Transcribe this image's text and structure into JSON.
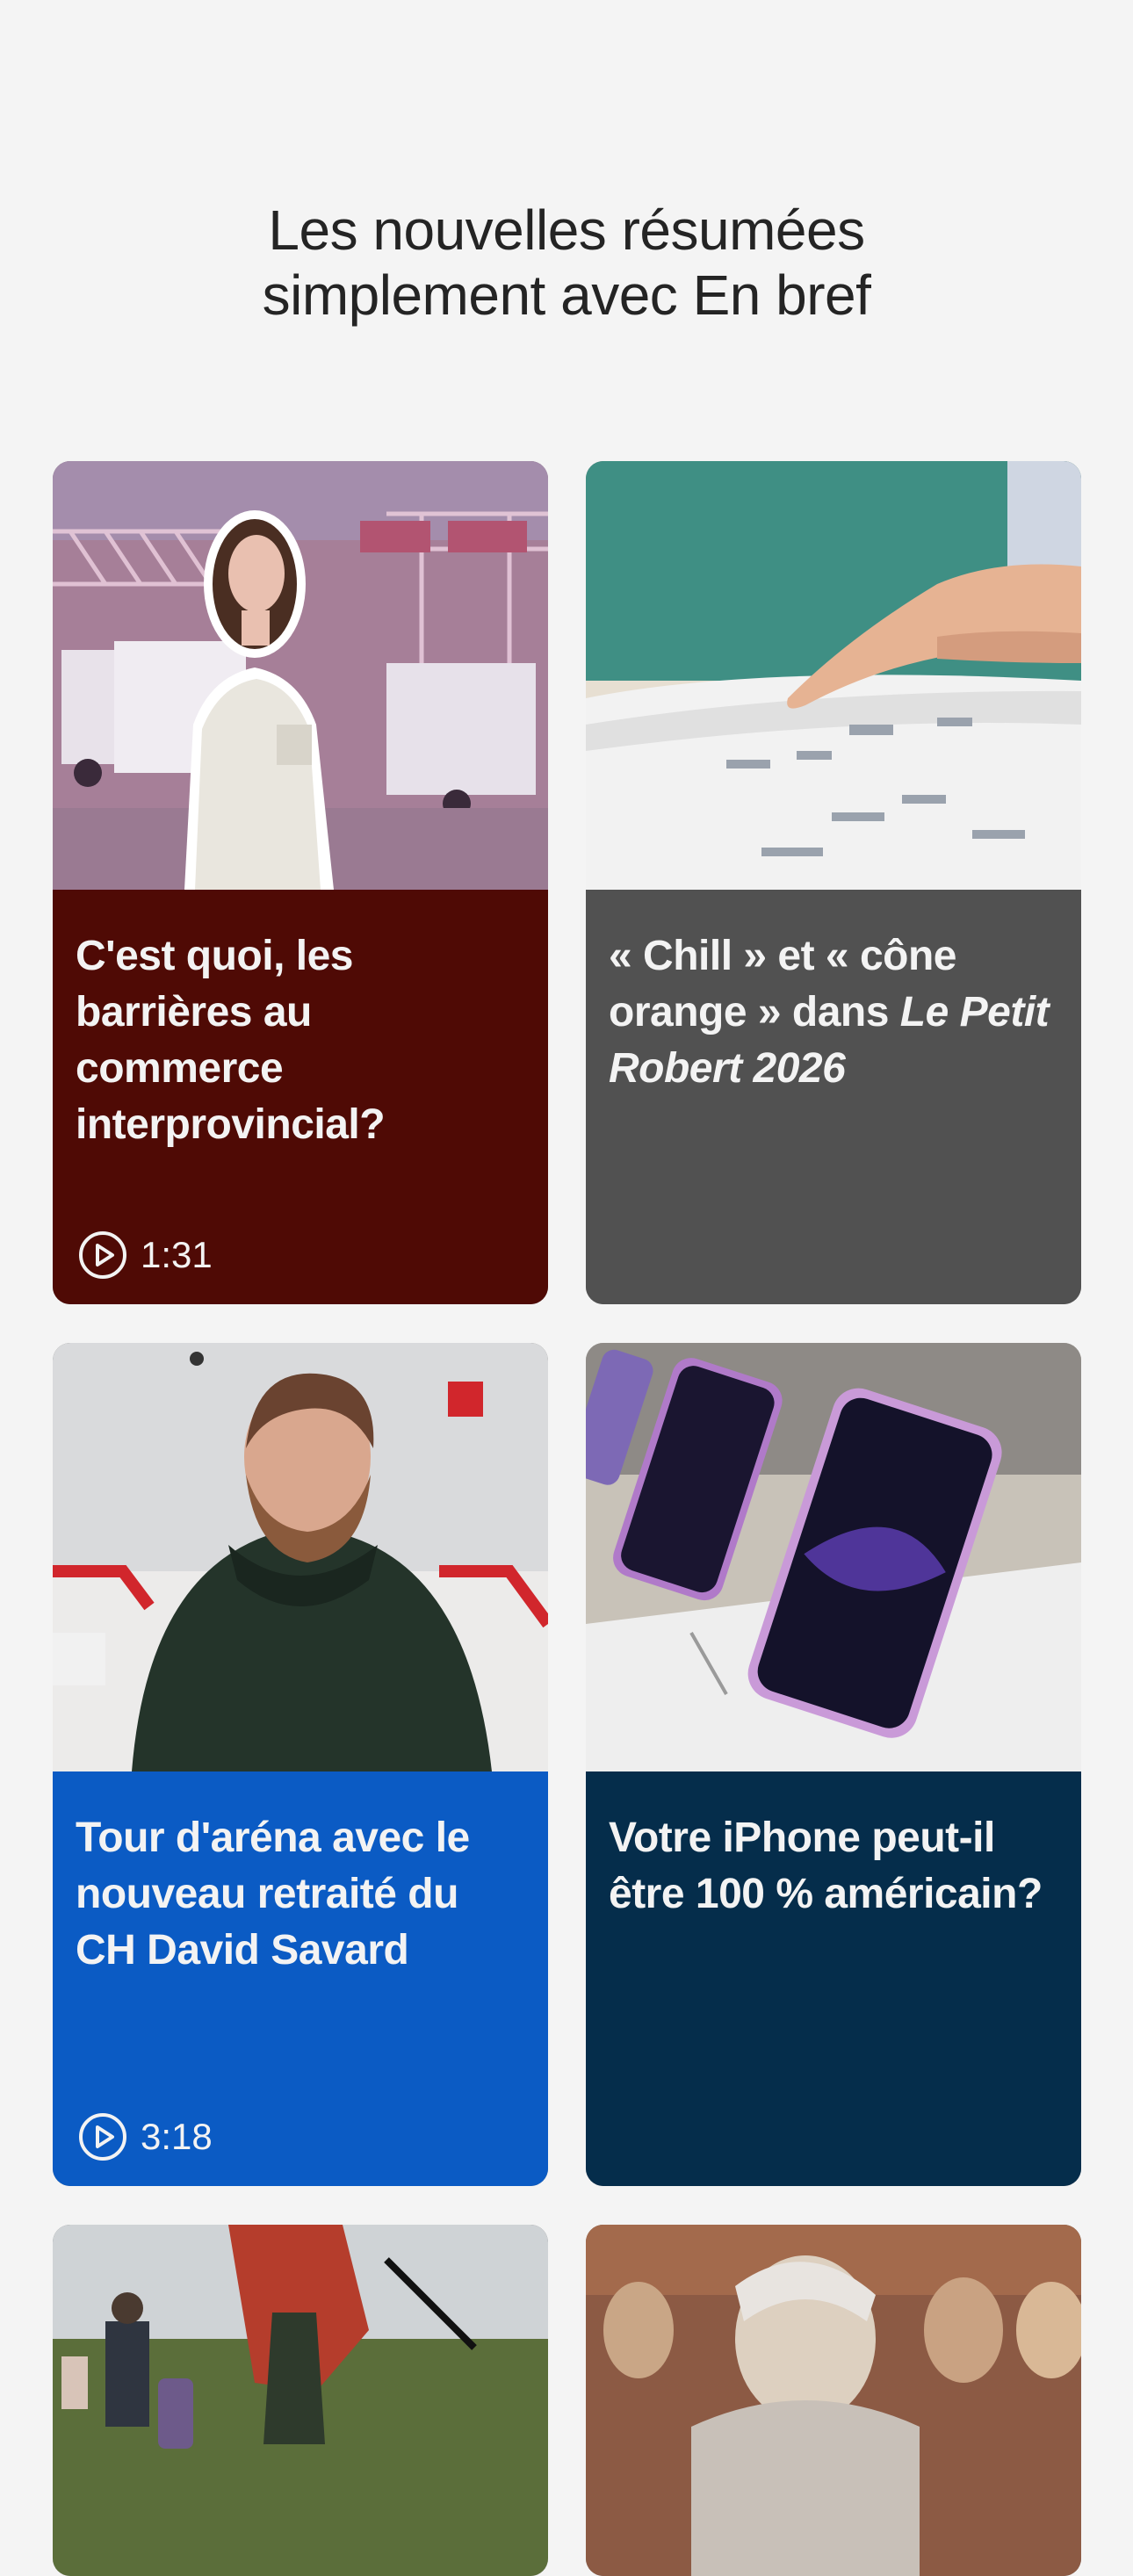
{
  "header": {
    "title_line1": "Les nouvelles résumées",
    "title_line2": "simplement avec En bref"
  },
  "cards": [
    {
      "title": "C'est quoi, les barrières au commerce interprovincial?",
      "duration": "1:31",
      "color": "#4f0a05",
      "image": "woman-standing-in-front-of-truck-at-border"
    },
    {
      "title_part1": "« Chill » et « cône orange » dans ",
      "title_italic": "Le Petit Robert 2026",
      "color": "#515151",
      "image": "finger-pointing-at-dictionary-pages"
    },
    {
      "title": "Tour d'aréna avec le nouveau retraité du CH David Savard",
      "duration": "3:18",
      "color": "#0b5bc4",
      "image": "bearded-man-in-green-hoodie-in-arena"
    },
    {
      "title": "Votre iPhone peut-il être 100 % américain?",
      "color": "#052d4b",
      "image": "iphones-on-store-display"
    },
    {
      "color": "#b8b8b8",
      "image": "people-with-luggage-crossing-field"
    },
    {
      "color": "#7a4a34",
      "image": "courtroom-sketch"
    }
  ],
  "icons": {
    "play": "play-circle-icon"
  }
}
